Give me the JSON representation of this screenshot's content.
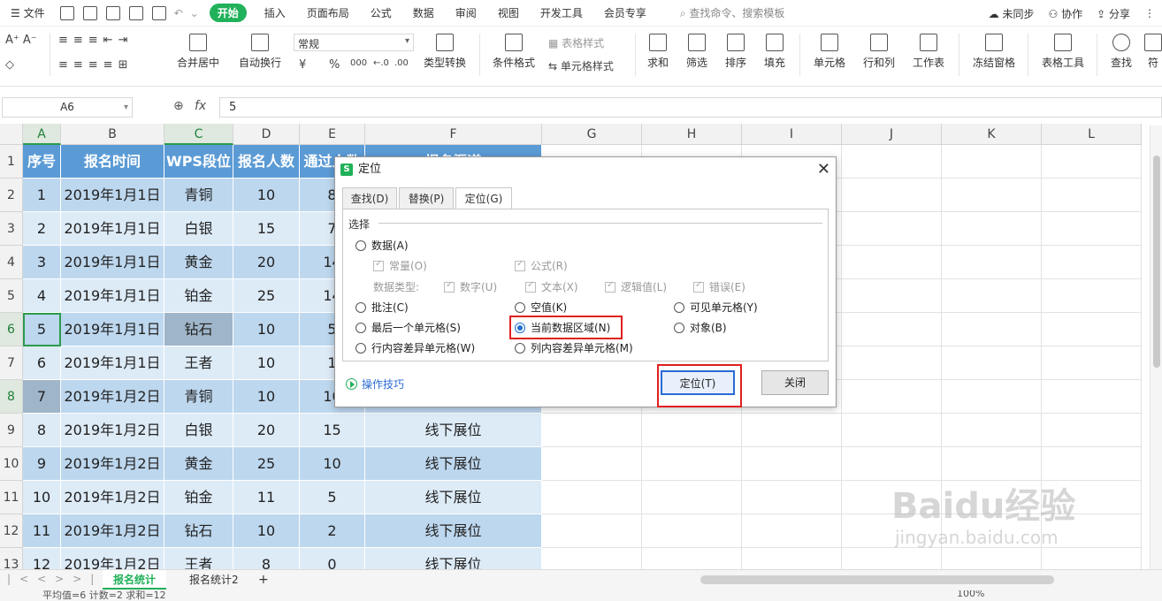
{
  "menu": {
    "items": [
      "文件",
      "开始",
      "插入",
      "页面布局",
      "公式",
      "数据",
      "审阅",
      "视图",
      "开发工具",
      "会员专享"
    ],
    "active": "开始",
    "search": "查找命令、搜索模板",
    "right": [
      "未同步",
      "协作",
      "分享"
    ]
  },
  "ribbon": {
    "font_name": "常规",
    "buttons": [
      "合并居中",
      "自动换行",
      "类型转换",
      "条件格式",
      "表格样式",
      "单元格样式",
      "求和",
      "筛选",
      "排序",
      "填充",
      "单元格",
      "行和列",
      "工作表",
      "冻结窗格",
      "表格工具",
      "查找",
      "符"
    ],
    "number_formats": [
      "¥",
      "%",
      "000",
      "←.0",
      ".00"
    ]
  },
  "formula_bar": {
    "cell_ref": "A6",
    "fx": "fx",
    "value": "5"
  },
  "grid": {
    "columns": [
      "A",
      "B",
      "C",
      "D",
      "E",
      "F",
      "G",
      "H",
      "I",
      "J",
      "K",
      "L"
    ],
    "selected_columns": [
      "A",
      "C"
    ],
    "rows": [
      "1",
      "2",
      "3",
      "4",
      "5",
      "6",
      "7",
      "8",
      "9",
      "10",
      "11",
      "12",
      "13"
    ],
    "selected_rows": [
      "6",
      "8"
    ],
    "header": [
      "序号",
      "报名时间",
      "WPS段位",
      "报名人数",
      "通过人数",
      "报名渠道"
    ],
    "data": [
      [
        "1",
        "2019年1月1日",
        "青铜",
        "10",
        "8",
        ""
      ],
      [
        "2",
        "2019年1月1日",
        "白银",
        "15",
        "7",
        ""
      ],
      [
        "3",
        "2019年1月1日",
        "黄金",
        "20",
        "14",
        ""
      ],
      [
        "4",
        "2019年1月1日",
        "铂金",
        "25",
        "14",
        ""
      ],
      [
        "5",
        "2019年1月1日",
        "钻石",
        "10",
        "5",
        ""
      ],
      [
        "6",
        "2019年1月1日",
        "王者",
        "10",
        "1",
        ""
      ],
      [
        "7",
        "2019年1月2日",
        "青铜",
        "10",
        "10",
        ""
      ],
      [
        "8",
        "2019年1月2日",
        "白银",
        "20",
        "15",
        "线下展位"
      ],
      [
        "9",
        "2019年1月2日",
        "黄金",
        "25",
        "10",
        "线下展位"
      ],
      [
        "10",
        "2019年1月2日",
        "铂金",
        "11",
        "5",
        "线下展位"
      ],
      [
        "11",
        "2019年1月2日",
        "钻石",
        "10",
        "2",
        "线下展位"
      ],
      [
        "12",
        "2019年1月2日",
        "王者",
        "8",
        "0",
        "线下展位"
      ]
    ]
  },
  "sheets": {
    "tabs": [
      "报名统计",
      "报名统计2"
    ],
    "active": "报名统计",
    "add": "+"
  },
  "status": {
    "text": "平均值=6  计数=2  求和=12",
    "zoom": "100%"
  },
  "dialog": {
    "title": "定位",
    "tabs": [
      "查找(D)",
      "替换(P)",
      "定位(G)"
    ],
    "active_tab": "定位(G)",
    "group_label": "选择",
    "options": {
      "data": "数据(A)",
      "constant": "常量(O)",
      "formula": "公式(R)",
      "data_type_label": "数据类型:",
      "number": "数字(U)",
      "text": "文本(X)",
      "logical": "逻辑值(L)",
      "error": "错误(E)",
      "comment": "批注(C)",
      "blank": "空值(K)",
      "visible": "可见单元格(Y)",
      "last_cell": "最后一个单元格(S)",
      "current_region": "当前数据区域(N)",
      "objects": "对象(B)",
      "row_diff": "行内容差异单元格(W)",
      "col_diff": "列内容差异单元格(M)"
    },
    "selected_option": "当前数据区域(N)",
    "tips_link": "操作技巧",
    "ok_button": "定位(T)",
    "close_button": "关闭"
  },
  "watermark": {
    "brand": "Baidu经验",
    "url": "jingyan.baidu.com"
  }
}
